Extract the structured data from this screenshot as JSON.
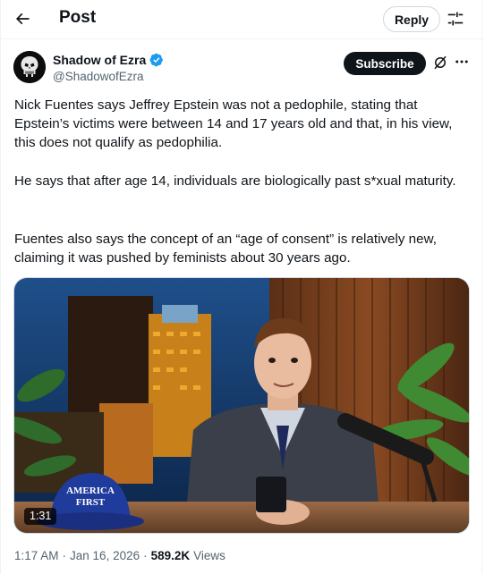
{
  "header": {
    "title": "Post",
    "reply_label": "Reply"
  },
  "author": {
    "name": "Shadow of Ezra",
    "handle": "@ShadowofEzra",
    "verified_color": "#1d9bf0",
    "subscribe_label": "Subscribe"
  },
  "post": {
    "paragraphs": [
      "Nick Fuentes says Jeffrey Epstein was not a pedophile, stating that Epstein’s victims were between 14 and 17 years old and that, in his view, this does not qualify as pedophilia.",
      "He says that after age 14, individuals are biologically past s*xual maturity.",
      "Fuentes also says the concept of an “age of consent” is relatively new, claiming it was pushed by feminists about 30 years ago."
    ],
    "video_duration": "1:31",
    "hat_text_line1": "AMERICA",
    "hat_text_line2": "FIRST"
  },
  "meta": {
    "time": "1:17 AM",
    "separator1": "·",
    "date": "Jan 16, 2026",
    "separator2": "·",
    "views_count": "589.2K",
    "views_label": "Views"
  },
  "icons": {
    "back": "arrow-left-icon",
    "filter": "sliders-icon",
    "verified": "verified-badge-icon",
    "grok": "grok-icon",
    "more": "more-dots-icon"
  }
}
